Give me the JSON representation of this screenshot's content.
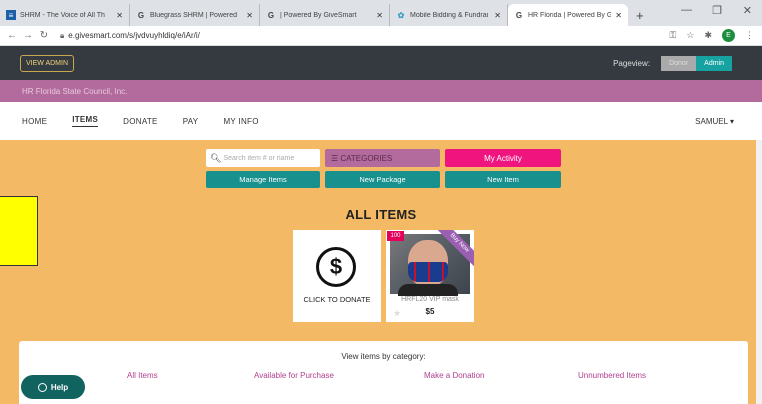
{
  "browser": {
    "tabs": [
      {
        "label": "SHRM - The Voice of All Th",
        "icon": "shrm-icon",
        "active": false
      },
      {
        "label": "Bluegrass SHRM | Powered",
        "icon": "givesmart-icon",
        "active": false
      },
      {
        "label": "| Powered By GiveSmart",
        "icon": "givesmart-icon",
        "active": false
      },
      {
        "label": "Mobile Bidding & Fundrai",
        "icon": "flower-icon",
        "active": false
      },
      {
        "label": "HR Florida | Powered By Gi",
        "icon": "givesmart-icon",
        "active": true
      }
    ],
    "new_tab": "+",
    "url": "e.givesmart.com/s/jvdvuyhldiq/e/iAr/i/",
    "profile_initial": "E"
  },
  "admin_bar": {
    "view_admin_label": "VIEW ADMIN",
    "pageview_label": "Pageview:",
    "donor_label": "Donor",
    "admin_label": "Admin"
  },
  "org": {
    "name": "HR Florida State Council, Inc."
  },
  "nav": {
    "items": [
      "HOME",
      "ITEMS",
      "DONATE",
      "PAY",
      "MY INFO"
    ],
    "active": "ITEMS",
    "user": "SAMUEL ▾"
  },
  "controls": {
    "search_placeholder": "Search item # or name",
    "categories_label": "☰ CATEGORIES",
    "my_activity_label": "My Activity",
    "manage_items_label": "Manage Items",
    "new_package_label": "New Package",
    "new_item_label": "New Item"
  },
  "main": {
    "title": "ALL ITEMS",
    "donate_card": {
      "label": "CLICK TO DONATE",
      "symbol": "$"
    },
    "item_card": {
      "badge": "100",
      "ribbon": "Buy Now",
      "name": "HRFL20 VIP mask",
      "price": "$5"
    }
  },
  "categories_panel": {
    "title": "View items by category:",
    "links": [
      "All Items",
      "Available for Purchase",
      "Make a Donation",
      "Unnumbered Items"
    ]
  },
  "help": {
    "label": "Help"
  },
  "colors": {
    "page_bg": "#f3b964",
    "admin_bar": "#343a40",
    "org_bar": "#b36a9d",
    "teal": "#17908e",
    "pink": "#f0157e",
    "help_bg": "#10635e"
  }
}
